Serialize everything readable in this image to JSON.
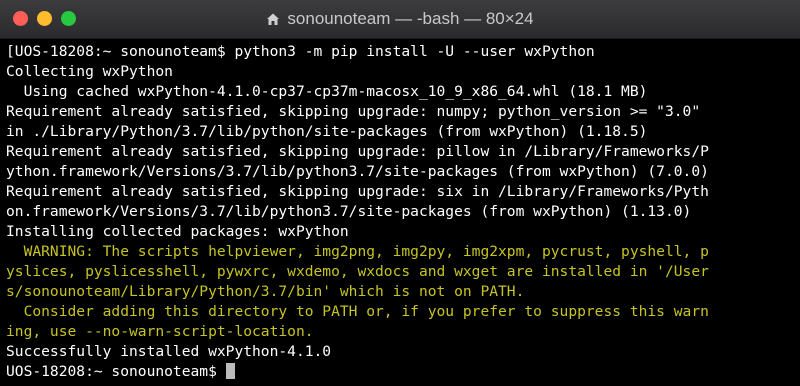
{
  "window": {
    "title": "sonounoteam — -bash — 80×24"
  },
  "colors": {
    "background": "#000000",
    "text": "#ffffff",
    "warning": "#c6c325",
    "close": "#ff5f57",
    "minimize": "#febc2e",
    "zoom": "#28c840"
  },
  "terminal": {
    "lines": [
      {
        "text": "[UOS-18208:~ sonounoteam$ python3 -m pip install -U --user wxPython",
        "kind": "normal"
      },
      {
        "text": "Collecting wxPython",
        "kind": "normal"
      },
      {
        "text": "  Using cached wxPython-4.1.0-cp37-cp37m-macosx_10_9_x86_64.whl (18.1 MB)",
        "kind": "normal"
      },
      {
        "text": "Requirement already satisfied, skipping upgrade: numpy; python_version >= \"3.0\"",
        "kind": "normal"
      },
      {
        "text": "in ./Library/Python/3.7/lib/python/site-packages (from wxPython) (1.18.5)",
        "kind": "normal"
      },
      {
        "text": "Requirement already satisfied, skipping upgrade: pillow in /Library/Frameworks/P",
        "kind": "normal"
      },
      {
        "text": "ython.framework/Versions/3.7/lib/python3.7/site-packages (from wxPython) (7.0.0)",
        "kind": "normal"
      },
      {
        "text": "Requirement already satisfied, skipping upgrade: six in /Library/Frameworks/Pyth",
        "kind": "normal"
      },
      {
        "text": "on.framework/Versions/3.7/lib/python3.7/site-packages (from wxPython) (1.13.0)",
        "kind": "normal"
      },
      {
        "text": "Installing collected packages: wxPython",
        "kind": "normal"
      },
      {
        "text": "  WARNING: The scripts helpviewer, img2png, img2py, img2xpm, pycrust, pyshell, p",
        "kind": "warn"
      },
      {
        "text": "yslices, pyslicesshell, pywxrc, wxdemo, wxdocs and wxget are installed in '/User",
        "kind": "warn"
      },
      {
        "text": "s/sonounoteam/Library/Python/3.7/bin' which is not on PATH.",
        "kind": "warn"
      },
      {
        "text": "  Consider adding this directory to PATH or, if you prefer to suppress this warn",
        "kind": "warn"
      },
      {
        "text": "ing, use --no-warn-script-location.",
        "kind": "warn"
      },
      {
        "text": "Successfully installed wxPython-4.1.0",
        "kind": "normal"
      }
    ],
    "prompt": "UOS-18208:~ sonounoteam$ "
  }
}
